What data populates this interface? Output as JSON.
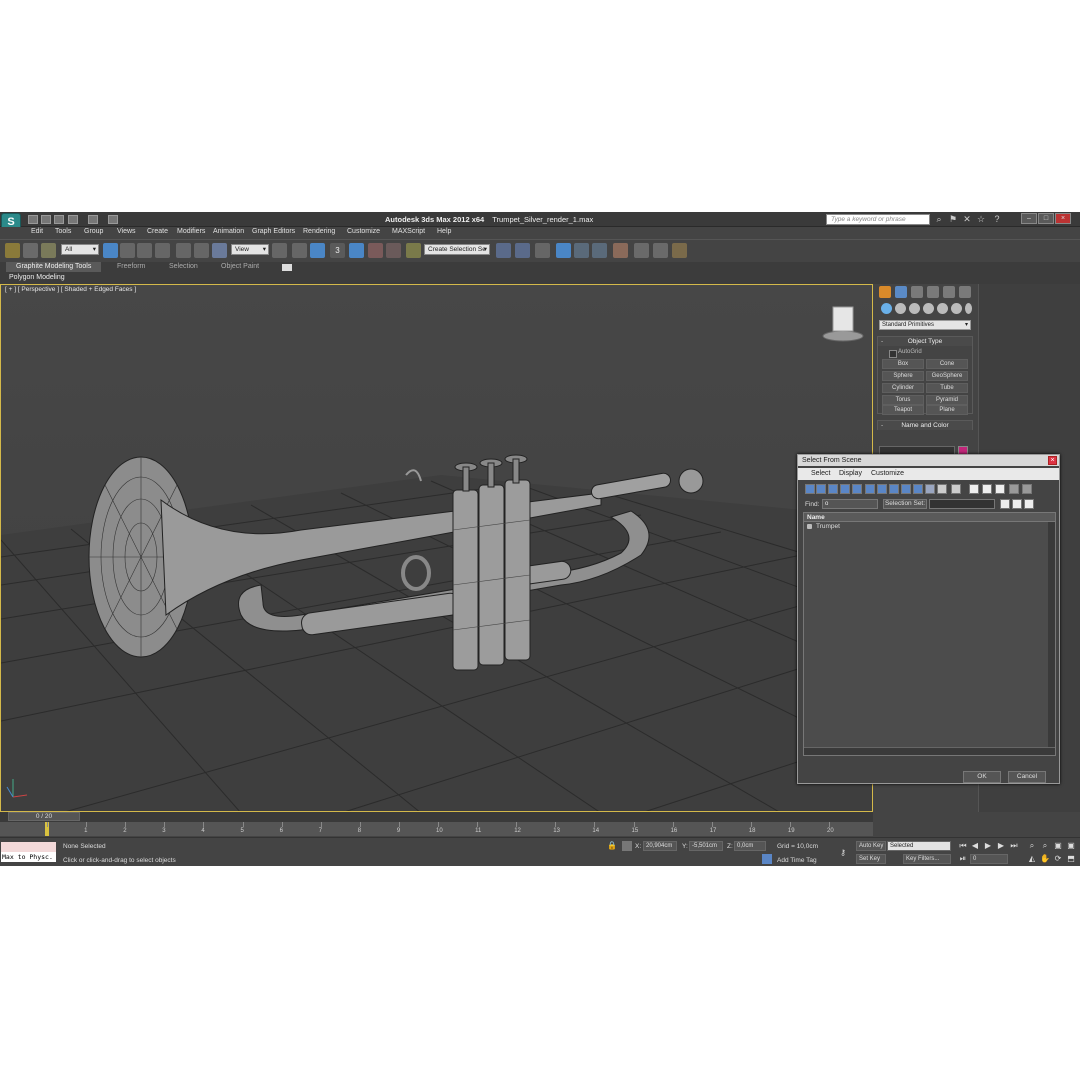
{
  "window": {
    "app_title": "Autodesk 3ds Max  2012 x64",
    "file_name": "Trumpet_Silver_render_1.max",
    "search_placeholder": "Type a keyword or phrase"
  },
  "menu": [
    "Edit",
    "Tools",
    "Group",
    "Views",
    "Create",
    "Modifiers",
    "Animation",
    "Graph Editors",
    "Rendering",
    "Customize",
    "MAXScript",
    "Help"
  ],
  "toolbar": {
    "selection_filter": "All",
    "ref_coord": "View",
    "named_selection": "Create Selection Se",
    "snap_label": "3"
  },
  "ribbon": {
    "tabs": [
      "Graphite Modeling Tools",
      "Freeform",
      "Selection",
      "Object Paint"
    ],
    "subtitle": "Polygon Modeling"
  },
  "viewport": {
    "label": "[ + ] [ Perspective ] [ Shaded + Edged Faces ]"
  },
  "command_panel": {
    "category": "Standard Primitives",
    "object_type_title": "Object Type",
    "autogrid": "AutoGrid",
    "primitives": [
      "Box",
      "Cone",
      "Sphere",
      "GeoSphere",
      "Cylinder",
      "Tube",
      "Torus",
      "Pyramid",
      "Teapot",
      "Plane"
    ],
    "name_color_title": "Name and Color",
    "object_color": "#c2267a"
  },
  "dialog": {
    "title": "Select From Scene",
    "menu": [
      "Select",
      "Display",
      "Customize"
    ],
    "find_label": "Find:",
    "find_value": "o",
    "selection_set_label": "Selection Set:",
    "column_name": "Name",
    "items": [
      "Trumpet"
    ],
    "ok": "OK",
    "cancel": "Cancel"
  },
  "timeline": {
    "frame_display": "0 / 20",
    "ticks": [
      "0",
      "1",
      "2",
      "3",
      "4",
      "5",
      "6",
      "7",
      "8",
      "9",
      "10",
      "11",
      "12",
      "13",
      "14",
      "15",
      "16",
      "17",
      "18",
      "19",
      "20"
    ]
  },
  "status": {
    "listener_text": "Max to Physc.",
    "selection": "None Selected",
    "prompt": "Click or click-and-drag to select objects",
    "x_label": "X:",
    "x_value": "20,904cm",
    "y_label": "Y:",
    "y_value": "-5,501cm",
    "z_label": "Z:",
    "z_value": "0,0cm",
    "grid": "Grid = 10,0cm",
    "add_time_tag": "Add Time Tag",
    "auto_key": "Auto Key",
    "set_key": "Set Key",
    "key_mode": "Selected",
    "key_filters": "Key Filters...",
    "current_frame": "0"
  }
}
